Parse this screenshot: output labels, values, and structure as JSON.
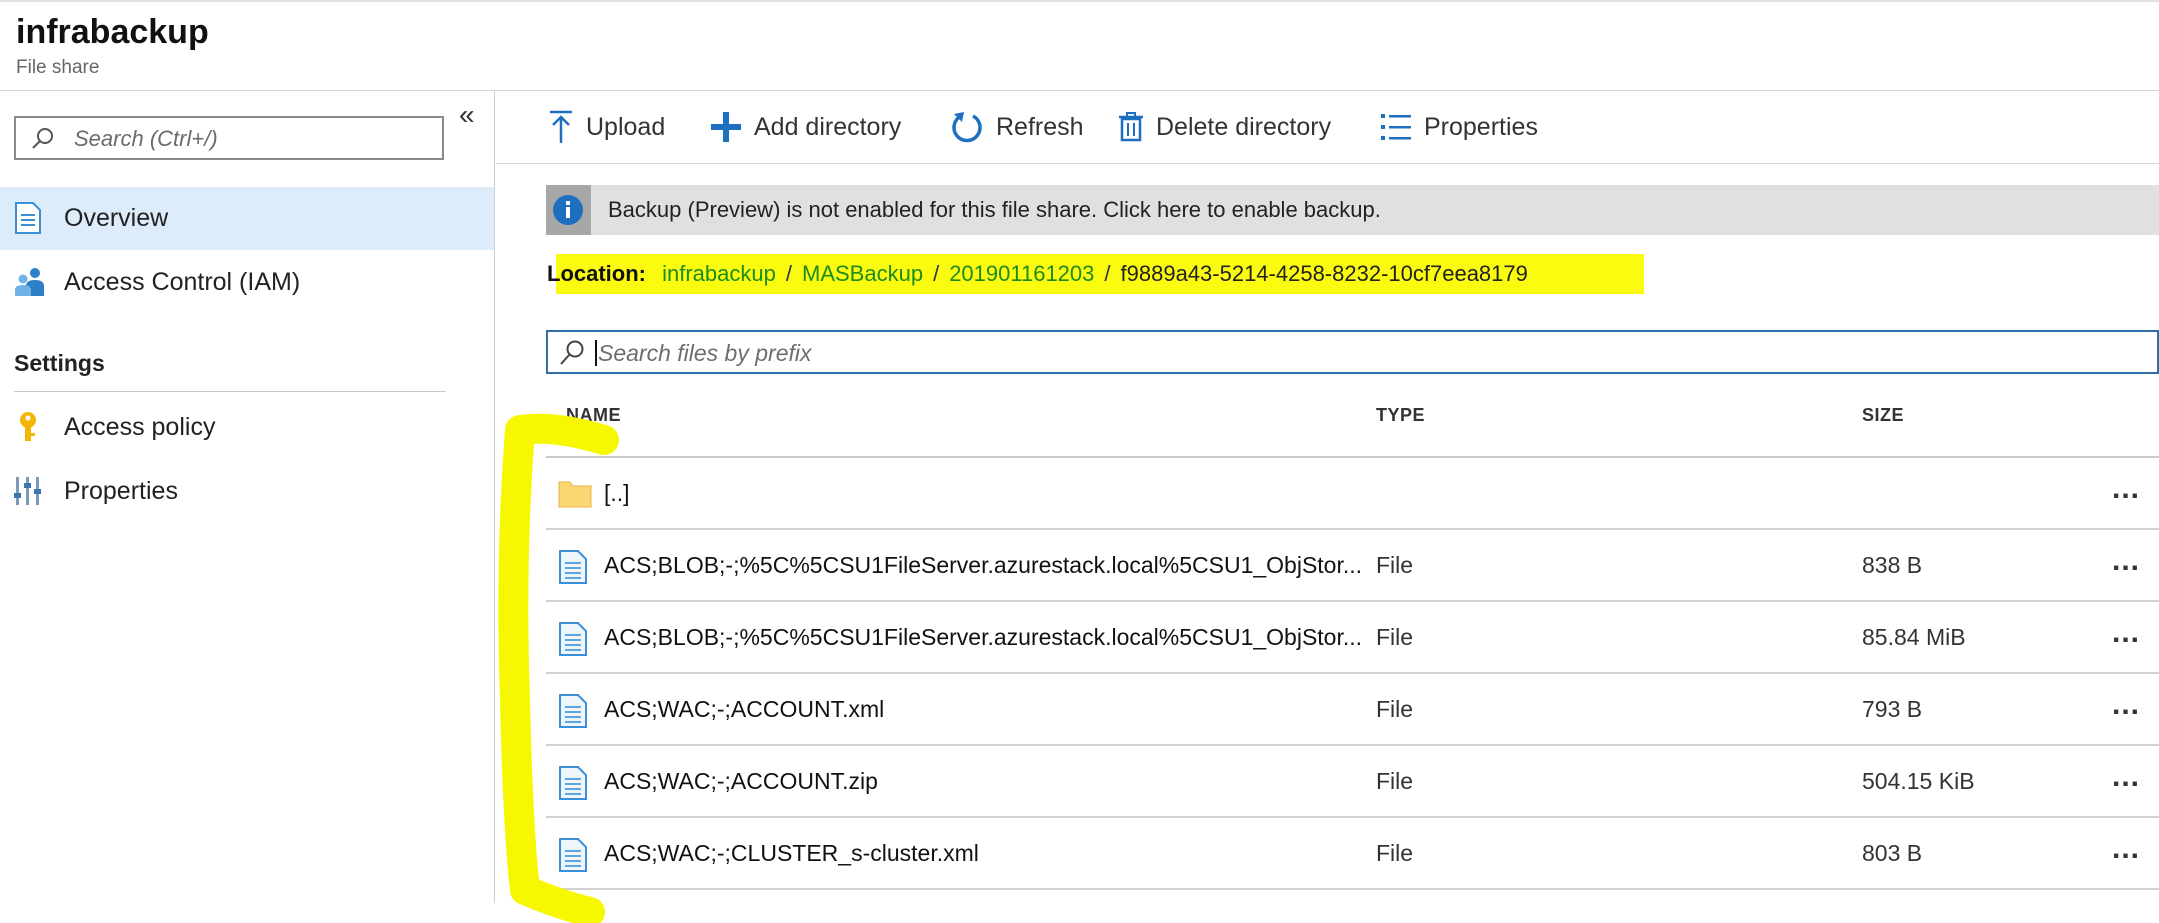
{
  "header": {
    "title": "infrabackup",
    "subtitle": "File share"
  },
  "sidebar": {
    "collapse_glyph": "«",
    "search_placeholder": "Search (Ctrl+/)",
    "items": [
      {
        "label": "Overview",
        "icon": "document-icon",
        "active": true
      },
      {
        "label": "Access Control (IAM)",
        "icon": "people-icon",
        "active": false
      }
    ],
    "settings_heading": "Settings",
    "settings_items": [
      {
        "label": "Access policy",
        "icon": "key-icon"
      },
      {
        "label": "Properties",
        "icon": "sliders-icon"
      }
    ]
  },
  "toolbar": {
    "upload": "Upload",
    "add_directory": "Add directory",
    "refresh": "Refresh",
    "delete_directory": "Delete directory",
    "properties": "Properties"
  },
  "banner": {
    "message": "Backup (Preview) is not enabled for this file share. Click here to enable backup."
  },
  "location": {
    "label": "Location:",
    "crumbs": [
      "infrabackup",
      "MASBackup",
      "201901161203"
    ],
    "current": "f9889a43-5214-4258-8232-10cf7eea8179",
    "separator": "/"
  },
  "file_search": {
    "placeholder": "Search files by prefix"
  },
  "table": {
    "columns": {
      "name": "NAME",
      "type": "TYPE",
      "size": "SIZE"
    },
    "rows": [
      {
        "name": "[..]",
        "type": "",
        "size": "",
        "icon": "folder-icon"
      },
      {
        "name": "ACS;BLOB;-;%5C%5CSU1FileServer.azurestack.local%5CSU1_ObjStor...",
        "type": "File",
        "size": "838 B",
        "icon": "file-icon"
      },
      {
        "name": "ACS;BLOB;-;%5C%5CSU1FileServer.azurestack.local%5CSU1_ObjStor...",
        "type": "File",
        "size": "85.84 MiB",
        "icon": "file-icon"
      },
      {
        "name": "ACS;WAC;-;ACCOUNT.xml",
        "type": "File",
        "size": "793 B",
        "icon": "file-icon"
      },
      {
        "name": "ACS;WAC;-;ACCOUNT.zip",
        "type": "File",
        "size": "504.15 KiB",
        "icon": "file-icon"
      },
      {
        "name": "ACS;WAC;-;CLUSTER_s-cluster.xml",
        "type": "File",
        "size": "803 B",
        "icon": "file-icon"
      }
    ],
    "more_glyph": "..."
  },
  "colors": {
    "accent_blue": "#0f6cbd",
    "highlight_yellow": "#fbfb10",
    "link_green": "#1d8c1d",
    "nav_active": "#ddecfa"
  }
}
